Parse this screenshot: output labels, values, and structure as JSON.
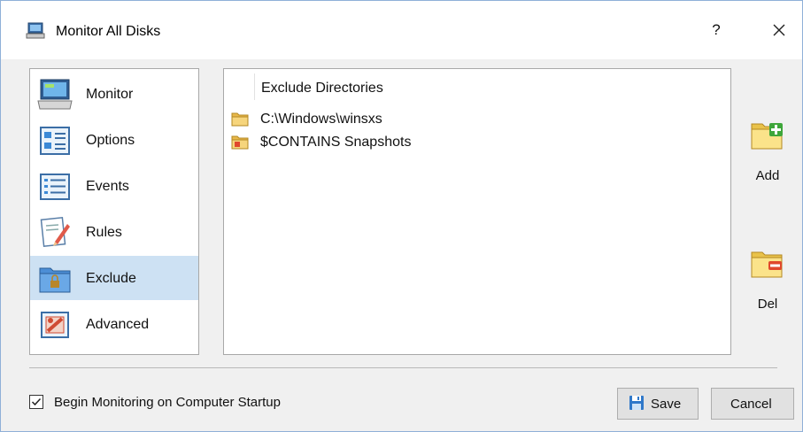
{
  "window": {
    "title": "Monitor All Disks",
    "help_label": "?",
    "close_icon": "close-icon",
    "accent_color": "#cde1f3"
  },
  "nav": {
    "items": [
      {
        "label": "Monitor",
        "icon": "monitor-icon",
        "selected": false
      },
      {
        "label": "Options",
        "icon": "options-icon",
        "selected": false
      },
      {
        "label": "Events",
        "icon": "events-icon",
        "selected": false
      },
      {
        "label": "Rules",
        "icon": "rules-icon",
        "selected": false
      },
      {
        "label": "Exclude",
        "icon": "exclude-folder-icon",
        "selected": true
      },
      {
        "label": "Advanced",
        "icon": "advanced-icon",
        "selected": false
      }
    ]
  },
  "exclude_list": {
    "column_header": "Exclude Directories",
    "rows": [
      {
        "text": "C:\\Windows\\winsxs",
        "icon": "folder-icon"
      },
      {
        "text": "$CONTAINS Snapshots",
        "icon": "folder-rule-icon"
      }
    ]
  },
  "side_buttons": {
    "add_label": "Add",
    "del_label": "Del"
  },
  "footer": {
    "startup_checkbox_label": "Begin Monitoring on Computer Startup",
    "startup_checked": true,
    "save_label": "Save",
    "cancel_label": "Cancel"
  }
}
